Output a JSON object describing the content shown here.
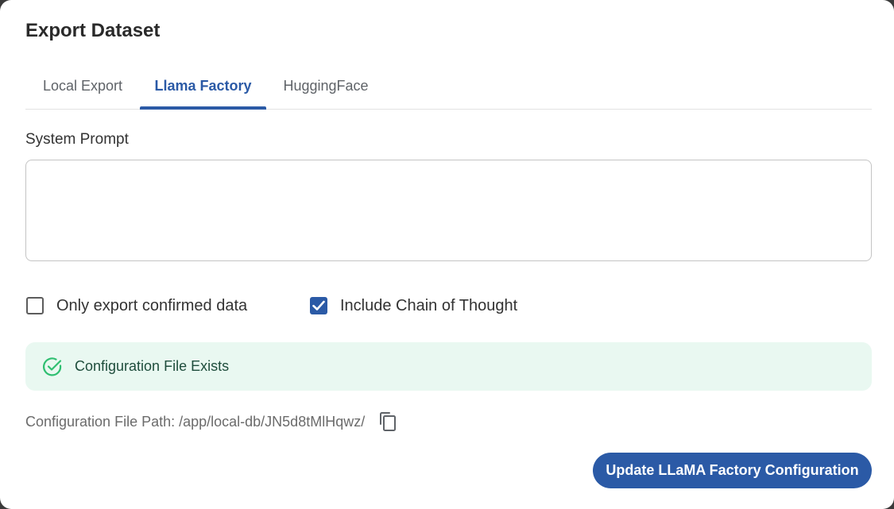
{
  "dialog": {
    "title": "Export Dataset"
  },
  "tabs": [
    {
      "label": "Local Export",
      "active": false
    },
    {
      "label": "Llama Factory",
      "active": true
    },
    {
      "label": "HuggingFace",
      "active": false
    }
  ],
  "system_prompt": {
    "label": "System Prompt",
    "value": "",
    "placeholder": ""
  },
  "options": {
    "confirmed_only": {
      "label": "Only export confirmed data",
      "checked": false
    },
    "chain_of_thought": {
      "label": "Include Chain of Thought",
      "checked": true
    }
  },
  "status": {
    "message": "Configuration File Exists",
    "icon": "check-circle-icon",
    "color": "#2fbf71"
  },
  "config_path": {
    "text": "Configuration File Path: /app/local-db/JN5d8tMlHqwz/",
    "copy_icon": "copy-icon"
  },
  "actions": {
    "update_label": "Update LLaMA Factory Configuration"
  },
  "colors": {
    "accent": "#2b5aa6",
    "success_bg": "#e9f8f1",
    "success": "#2fbf71"
  }
}
